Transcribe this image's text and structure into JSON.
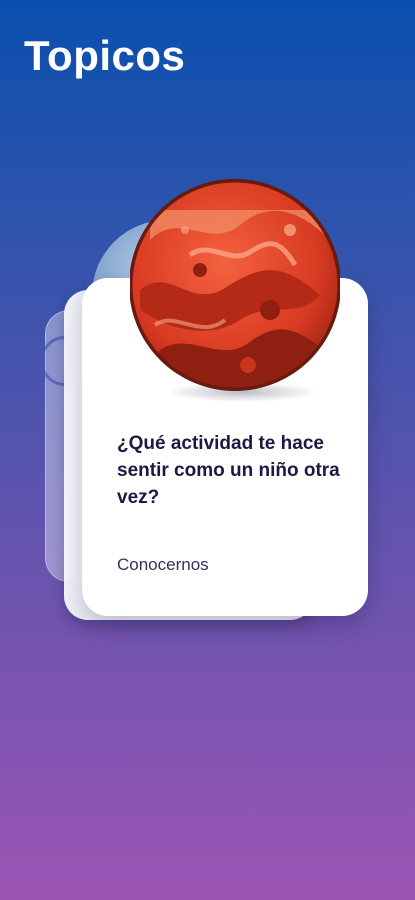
{
  "header": {
    "title": "Topicos"
  },
  "card": {
    "question": "¿Qué actividad te hace sentir como un niño otra vez?",
    "category": "Conocernos",
    "planet_icon": "planet-icon"
  },
  "colors": {
    "background_top": "#0a4fae",
    "background_bottom": "#9b55b4",
    "card": "#ffffff",
    "question_text": "#1c1a44",
    "planet": "#e0412b"
  }
}
